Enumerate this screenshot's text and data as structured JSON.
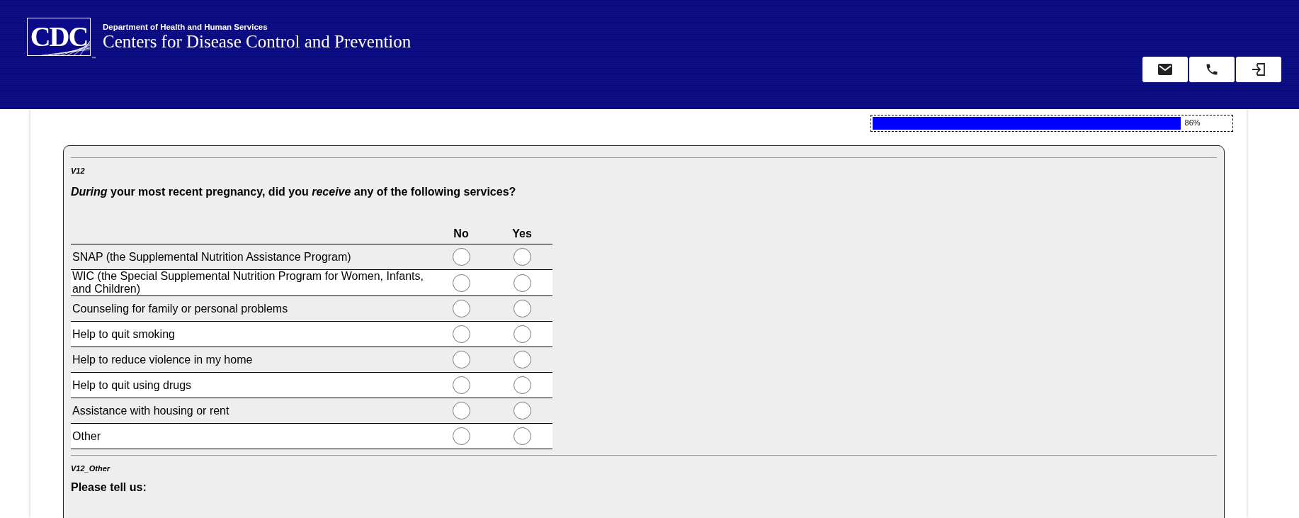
{
  "header": {
    "logo": {
      "letters": "CDC",
      "trademark": "™"
    },
    "department": "Department of Health and Human Services",
    "agency": "Centers for Disease Control and Prevention",
    "buttons": [
      {
        "kind": "email"
      },
      {
        "kind": "phone"
      },
      {
        "kind": "exit"
      }
    ]
  },
  "progress": {
    "level": 0.86,
    "reading": "86%"
  },
  "questions": [
    {
      "kind": "grid",
      "code": "V12",
      "prompt": "*During* your most recent pregnancy, did you *receive* any of the following services?",
      "columns": [
        "No",
        "Yes"
      ],
      "rows": [
        {
          "label": "SNAP (the Supplemental Nutrition Assistance Program)",
          "options": [
            {
              "selected": false
            },
            {
              "selected": false
            }
          ]
        },
        {
          "label": "WIC (the Special Supplemental Nutrition Program for Women, Infants, and Children)",
          "options": [
            {
              "selected": false
            },
            {
              "selected": false
            }
          ]
        },
        {
          "label": "Counseling for family or personal problems",
          "options": [
            {
              "selected": false
            },
            {
              "selected": false
            }
          ]
        },
        {
          "label": "Help to quit smoking",
          "options": [
            {
              "selected": false
            },
            {
              "selected": false
            }
          ]
        },
        {
          "label": "Help to reduce violence in my home",
          "options": [
            {
              "selected": false
            },
            {
              "selected": false
            }
          ]
        },
        {
          "label": "Help to quit using drugs",
          "options": [
            {
              "selected": false
            },
            {
              "selected": false
            }
          ]
        },
        {
          "label": "Assistance with housing or rent",
          "options": [
            {
              "selected": false
            },
            {
              "selected": false
            }
          ]
        },
        {
          "label": "Other",
          "options": [
            {
              "selected": false
            },
            {
              "selected": false
            }
          ]
        }
      ]
    },
    {
      "kind": "text",
      "code": "V12_Other",
      "prompt": "Please tell us:"
    }
  ]
}
